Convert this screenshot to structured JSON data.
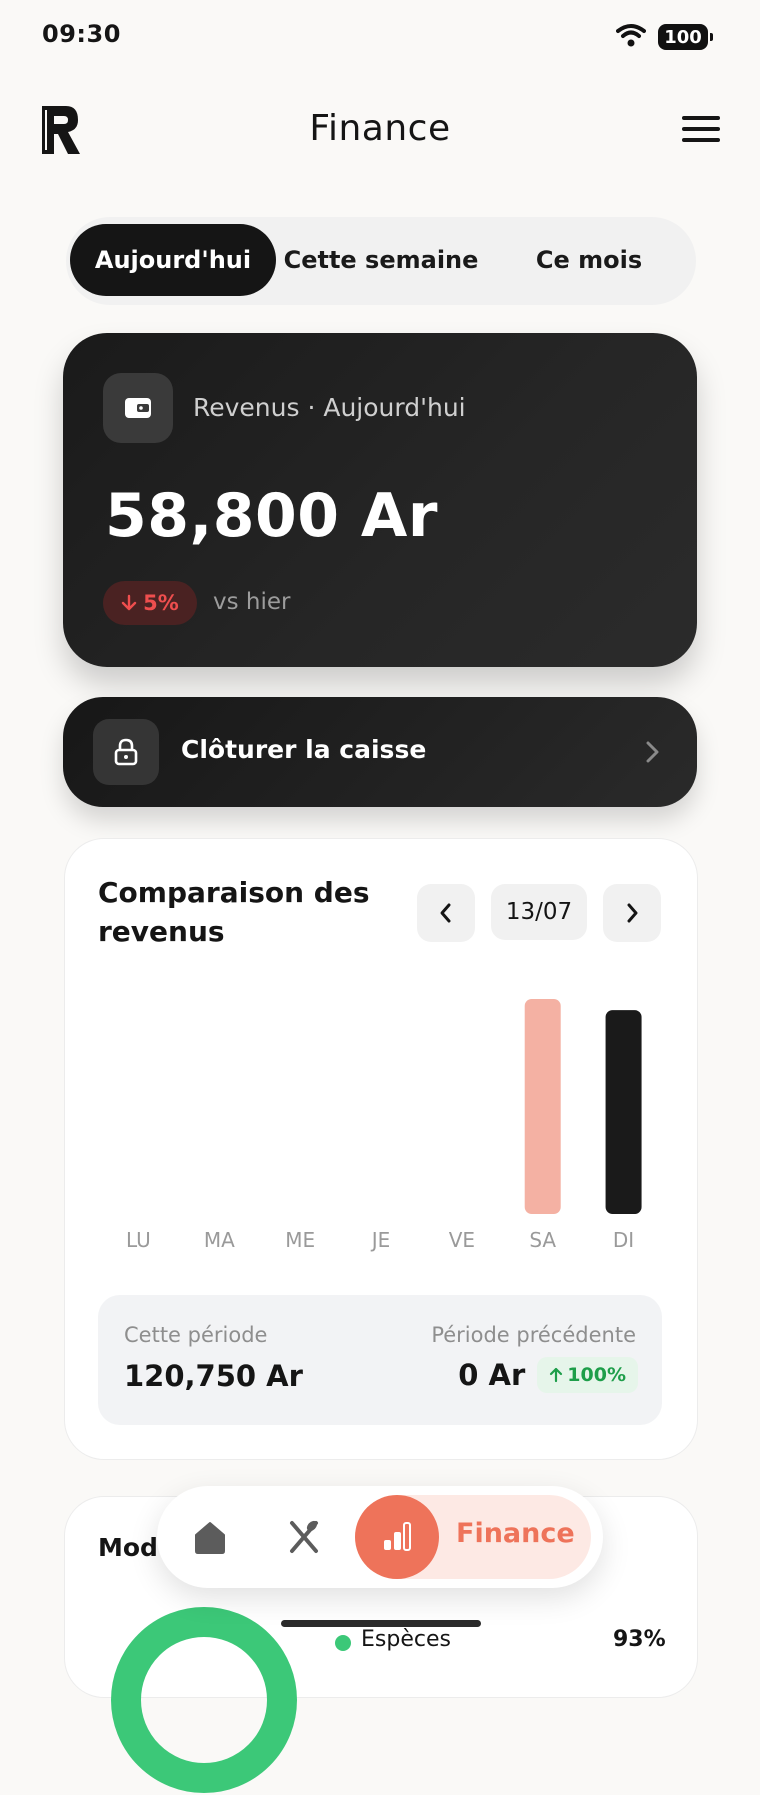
{
  "status_bar": {
    "time": "09:30",
    "battery": "100"
  },
  "header": {
    "title": "Finance",
    "logo_icon": "restaurant-r-logo",
    "menu_icon": "hamburger-icon"
  },
  "tabs": [
    {
      "label": "Aujourd'hui",
      "active": true
    },
    {
      "label": "Cette semaine",
      "active": false
    },
    {
      "label": "Ce mois",
      "active": false
    }
  ],
  "revenue_card": {
    "icon": "wallet-icon",
    "label": "Revenus · Aujourd'hui",
    "amount": "58,800 Ar",
    "delta": "5%",
    "delta_direction": "down",
    "delta_caption": "vs hier"
  },
  "close_register": {
    "icon": "lock-icon",
    "label": "Clôturer la caisse"
  },
  "comparison": {
    "title": "Comparaison des revenus",
    "date": "13/07",
    "summary": {
      "current_label": "Cette période",
      "current_value": "120,750 Ar",
      "previous_label": "Période précédente",
      "previous_value": "0 Ar",
      "change": "100%"
    }
  },
  "chart_data": {
    "type": "bar",
    "categories": [
      "LU",
      "MA",
      "ME",
      "JE",
      "VE",
      "SA",
      "DI"
    ],
    "values": [
      0,
      0,
      0,
      0,
      0,
      62000,
      58800
    ],
    "colors": [
      "#1a1a1a",
      "#1a1a1a",
      "#1a1a1a",
      "#1a1a1a",
      "#1a1a1a",
      "#f4b1a3",
      "#1a1a1a"
    ],
    "ylim": [
      0,
      62000
    ]
  },
  "payment_card": {
    "title": "Mode",
    "legend_label": "Espèces",
    "legend_pct": "93%",
    "color": "#3cc878"
  },
  "bottom_nav": {
    "items": [
      {
        "icon": "home-icon"
      },
      {
        "icon": "utensils-icon"
      },
      {
        "icon": "chart-bar-icon",
        "label": "Finance",
        "active": true
      }
    ],
    "accent": "#ee735a"
  }
}
